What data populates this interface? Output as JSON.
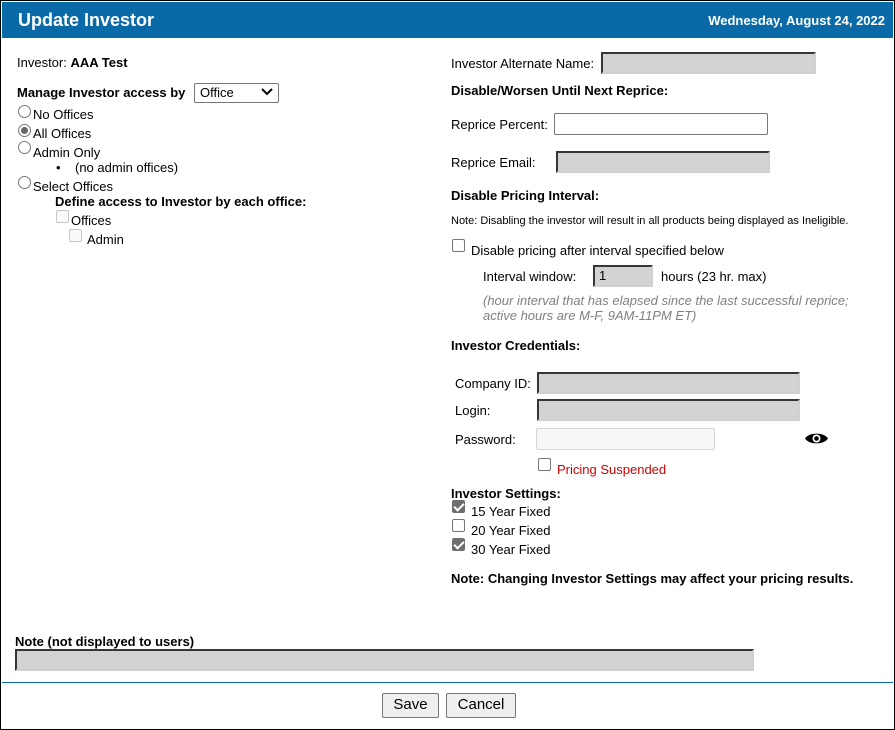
{
  "header": {
    "title": "Update Investor",
    "date": "Wednesday, August 24, 2022"
  },
  "left": {
    "investor_label": "Investor:",
    "investor_name": "AAA Test",
    "manage_label": "Manage Investor access by",
    "manage_select_value": "Office",
    "radio_no_offices": "No Offices",
    "radio_all_offices": "All Offices",
    "radio_admin_only": "Admin Only",
    "admin_bullet": "(no admin offices)",
    "radio_select_offices": "Select Offices",
    "define_access_label": "Define access to Investor by each office:",
    "offices_label": "Offices",
    "admin_label": "Admin",
    "selected_radio": "All Offices"
  },
  "right": {
    "alt_name_label": "Investor Alternate Name:",
    "alt_name_value": "",
    "disable_worsen_heading": "Disable/Worsen Until Next Reprice:",
    "reprice_percent_label": "Reprice Percent:",
    "reprice_percent_value": "",
    "reprice_email_label": "Reprice Email:",
    "reprice_email_value": "",
    "disable_pricing_heading": "Disable Pricing Interval:",
    "disable_note": "Note: Disabling the investor will result in all products being displayed as Ineligible.",
    "disable_interval_label": "Disable pricing after interval specified below",
    "disable_interval_checked": false,
    "interval_window_label": "Interval window:",
    "interval_window_value": "1",
    "interval_hours_label": "hours (23 hr. max)",
    "interval_hint_line1": "(hour interval that has elapsed since the last successful reprice;",
    "interval_hint_line2": "active hours are M-F, 9AM-11PM ET)",
    "credentials_heading": "Investor Credentials:",
    "company_id_label": "Company ID:",
    "company_id_value": "",
    "login_label": "Login:",
    "login_value": "",
    "password_label": "Password:",
    "password_value": "",
    "show_password_icon": "eye-icon",
    "pricing_suspended_label": "Pricing Suspended",
    "pricing_suspended_checked": false,
    "settings_heading": "Investor Settings:",
    "settings": [
      {
        "label": "15 Year Fixed",
        "checked": true
      },
      {
        "label": "20 Year Fixed",
        "checked": false
      },
      {
        "label": "30 Year Fixed",
        "checked": true
      }
    ],
    "settings_note": "Note: Changing Investor Settings may affect your pricing results."
  },
  "note": {
    "label": "Note (not displayed to users)",
    "value": ""
  },
  "footer": {
    "save_label": "Save",
    "cancel_label": "Cancel"
  },
  "colors": {
    "titlebar": "#0a6aa8",
    "suspended_text": "#d00000"
  }
}
